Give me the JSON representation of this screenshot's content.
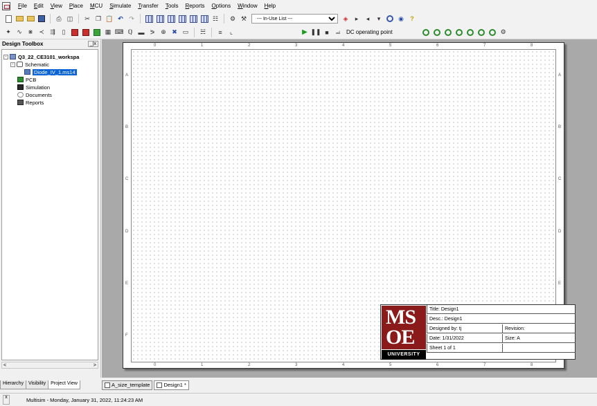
{
  "menu": [
    "File",
    "Edit",
    "View",
    "Place",
    "MCU",
    "Simulate",
    "Transfer",
    "Tools",
    "Reports",
    "Options",
    "Window",
    "Help"
  ],
  "toolbar": {
    "inuse_list": "--- In-Use List ---",
    "dc_label": "DC operating point"
  },
  "toolbox": {
    "title": "Design Toolbox",
    "close": "_|x",
    "workspace": "Q3_22_CE3101_workspa",
    "schematic": "Schematic",
    "file": "Diode_IV_1.ms14",
    "pcb": "PCB",
    "simulation": "Simulation",
    "documents": "Documents",
    "reports": "Reports",
    "tabs": [
      "Hierarchy",
      "Visibility",
      "Project View"
    ]
  },
  "sheet": {
    "col_labels": [
      "0",
      "1",
      "2",
      "3",
      "4",
      "5",
      "6",
      "7",
      "8"
    ],
    "row_labels": [
      "A",
      "B",
      "C",
      "D",
      "E",
      "F"
    ],
    "titleblock": {
      "logo_top": "MS",
      "logo_bottom": "OE",
      "university": "UNIVERSITY",
      "title": "Title:  Design1",
      "desc": "Desc.: Design1",
      "designed_by": "Designed by:  tj",
      "revision": "Revision:",
      "date": "Date:  1/31/2022",
      "size": "Size:       A",
      "sheet": "Sheet   1    of   1"
    }
  },
  "doc_tabs": [
    "A_size_template",
    "Design1 *"
  ],
  "status": "Multisim  -  Monday, January 31, 2022, 11:24:23 AM",
  "status_close": "x"
}
